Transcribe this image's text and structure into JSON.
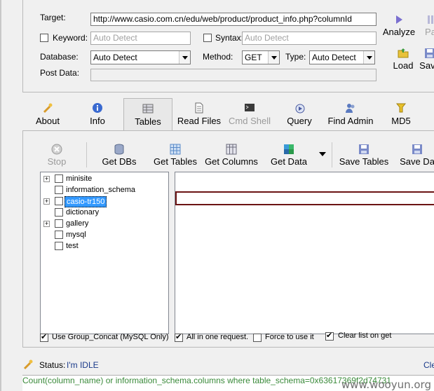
{
  "target": {
    "label": "Target:",
    "value": "http://www.casio.com.cn/edu/web/product/product_info.php?columnId"
  },
  "keyword": {
    "label": "Keyword:",
    "placeholder": "Auto Detect"
  },
  "syntax": {
    "label": "Syntax:",
    "placeholder": "Auto Detect"
  },
  "database": {
    "label": "Database:",
    "value": "Auto Detect"
  },
  "method": {
    "label": "Method:",
    "value": "GET"
  },
  "type": {
    "label": "Type:",
    "value": "Auto Detect"
  },
  "post_data": {
    "label": "Post Data:"
  },
  "right_tools": {
    "analyze": "Analyze",
    "pause": "Pa",
    "load": "Load",
    "save": "Save"
  },
  "tabs": [
    {
      "label": "About",
      "icon": "wand-icon"
    },
    {
      "label": "Info",
      "icon": "info-icon"
    },
    {
      "label": "Tables",
      "icon": "table-icon"
    },
    {
      "label": "Read Files",
      "icon": "file-icon"
    },
    {
      "label": "Cmd Shell",
      "icon": "terminal-icon"
    },
    {
      "label": "Query",
      "icon": "query-icon"
    },
    {
      "label": "Find Admin",
      "icon": "users-icon"
    },
    {
      "label": "MD5",
      "icon": "key-icon"
    }
  ],
  "toolbar": {
    "stop": "Stop",
    "get_dbs": "Get DBs",
    "get_tables": "Get Tables",
    "get_columns": "Get Columns",
    "get_data": "Get Data",
    "save_tables": "Save Tables",
    "save_data": "Save Da"
  },
  "tree": [
    {
      "name": "minisite",
      "expandable": true
    },
    {
      "name": "information_schema",
      "expandable": false
    },
    {
      "name": "casio-tr150",
      "expandable": true,
      "selected": true
    },
    {
      "name": "dictionary",
      "expandable": false
    },
    {
      "name": "gallery",
      "expandable": true
    },
    {
      "name": "mysql",
      "expandable": false
    },
    {
      "name": "test",
      "expandable": false
    }
  ],
  "options": {
    "use_group_concat": "Use Group_Concat (MySQL Only)",
    "all_in_one": "All in one request.",
    "force_use": "Force to use it",
    "clear_list": "Clear list on get"
  },
  "status": {
    "label": "Status:",
    "value": "I'm IDLE",
    "clear": "Cle"
  },
  "log_line": "Count(column_name) or information_schema.columns where table_schema=0x63617369f2d74731",
  "watermark": "www.wooyun.org"
}
